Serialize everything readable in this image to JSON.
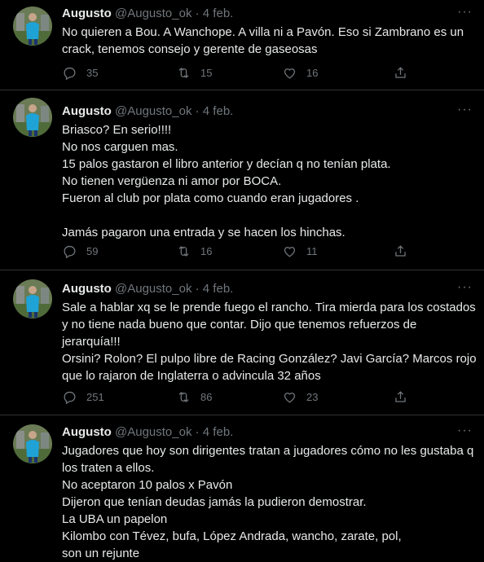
{
  "tweets": [
    {
      "name": "Augusto",
      "handle": "@Augusto_ok",
      "dot": "·",
      "date": "4 feb.",
      "lines": [
        "No quieren a Bou. A Wanchope. A villa ni a Pavón. Eso si Zambrano es un",
        "crack, tenemos consejo y gerente de gaseosas"
      ],
      "replies": "35",
      "retweets": "15",
      "likes": "16"
    },
    {
      "name": "Augusto",
      "handle": "@Augusto_ok",
      "dot": "·",
      "date": "4 feb.",
      "lines": [
        "Briasco? En serio!!!!",
        "No nos carguen mas.",
        "15 palos gastaron el libro anterior y decían q no tenían plata.",
        "No tienen vergüenza ni amor por BOCA.",
        "Fueron al club por plata como cuando eran jugadores .",
        "",
        "Jamás pagaron una entrada y se hacen los hinchas."
      ],
      "replies": "59",
      "retweets": "16",
      "likes": "11"
    },
    {
      "name": "Augusto",
      "handle": "@Augusto_ok",
      "dot": "·",
      "date": "4 feb.",
      "lines": [
        "Sale a hablar xq se le prende fuego el rancho. Tira mierda para los costados",
        "y no tiene nada bueno que contar. Dijo que tenemos refuerzos de",
        "jerarquía!!!",
        "Orsini? Rolon? El pulpo libre de Racing González? Javi García? Marcos rojo",
        "que lo rajaron de Inglaterra o advincula 32 años"
      ],
      "replies": "251",
      "retweets": "86",
      "likes": "23"
    },
    {
      "name": "Augusto",
      "handle": "@Augusto_ok",
      "dot": "·",
      "date": "4 feb.",
      "lines": [
        "Jugadores que hoy son dirigentes tratan a jugadores cómo no les gustaba q",
        "los traten a ellos.",
        "No aceptaron 10 palos x Pavón",
        "Dijeron que tenían deudas jamás la pudieron demostrar.",
        "La UBA un papelon",
        "Kilombo con Tévez, bufa, López Andrada, wancho, zarate, pol,",
        "son un rejunte"
      ],
      "replies": "",
      "retweets": "",
      "likes": ""
    }
  ],
  "icons": {
    "more": "more-horizontal-icon",
    "reply": "reply-icon",
    "retweet": "retweet-icon",
    "like": "heart-icon",
    "share": "share-icon"
  },
  "colors": {
    "background": "#000000",
    "text": "#e7e9ea",
    "muted": "#71767b",
    "divider": "#2f3336"
  }
}
